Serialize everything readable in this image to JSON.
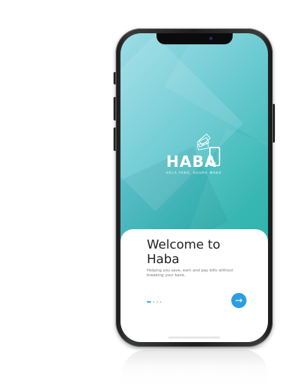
{
  "logo": {
    "text": "HABA",
    "tagline": "HELA YAKO, UHURU WAKO"
  },
  "onboarding": {
    "title": "Welcome to Haba",
    "subtitle": "Helping you save, earn and pay bills without breaking your bank.",
    "current_page": 1,
    "total_pages": 4
  },
  "next_button": {
    "icon": "arrow-right-icon",
    "glyph": "→"
  },
  "colors": {
    "gradient_start": "#9fdde6",
    "gradient_end": "#11a89e",
    "accent": "#2a9ee0"
  }
}
